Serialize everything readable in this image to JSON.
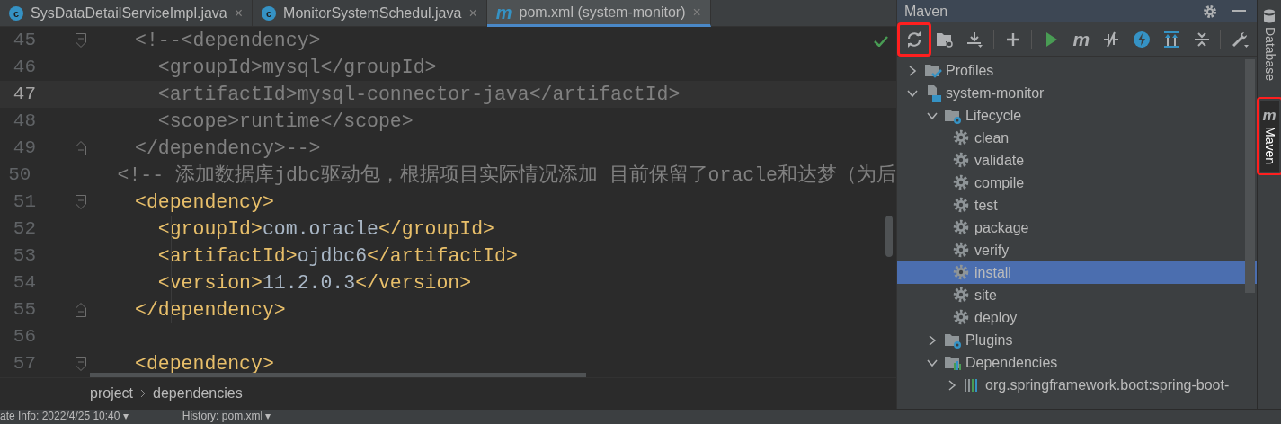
{
  "tabs": [
    {
      "label": "SysDataDetailServiceImpl.java",
      "kind": "class",
      "icon_glyph": "c",
      "close": "×",
      "selected": false
    },
    {
      "label": "MonitorSystemSchedul.java",
      "kind": "class",
      "icon_glyph": "c",
      "close": "×",
      "selected": false
    },
    {
      "label": "pom.xml (system-monitor)",
      "kind": "maven",
      "icon_glyph": "m",
      "close": "×",
      "selected": true
    }
  ],
  "editor": {
    "lines": [
      {
        "number": "45",
        "current": false,
        "fold_start": true,
        "segments": [
          {
            "kind": "comment",
            "text": "<!--<dependency>"
          }
        ]
      },
      {
        "number": "46",
        "current": false,
        "segments": [
          {
            "kind": "comment",
            "text": "  <groupId>mysql</groupId>"
          }
        ]
      },
      {
        "number": "47",
        "current": true,
        "segments": [
          {
            "kind": "comment",
            "text": "  <artifactId>mysql-connector-java</artifactId>"
          }
        ]
      },
      {
        "number": "48",
        "current": false,
        "segments": [
          {
            "kind": "comment",
            "text": "  <scope>runtime</scope>"
          }
        ]
      },
      {
        "number": "49",
        "current": false,
        "fold_end": true,
        "segments": [
          {
            "kind": "comment",
            "text": "</dependency>-->"
          }
        ]
      },
      {
        "number": "50",
        "current": false,
        "segments": [
          {
            "kind": "comment",
            "text": "<!-- 添加数据库jdbc驱动包，根据项目实际情况添加 目前保留了oracle和达梦（为后"
          }
        ]
      },
      {
        "number": "51",
        "current": false,
        "fold_start": true,
        "segments": [
          {
            "kind": "tag",
            "text": "<dependency>"
          }
        ]
      },
      {
        "number": "52",
        "current": false,
        "segments": [
          {
            "kind": "tag",
            "text": "  <groupId>"
          },
          {
            "kind": "text",
            "text": "com.oracle"
          },
          {
            "kind": "tag",
            "text": "</groupId>"
          }
        ]
      },
      {
        "number": "53",
        "current": false,
        "segments": [
          {
            "kind": "tag",
            "text": "  <artifactId>"
          },
          {
            "kind": "text",
            "text": "ojdbc6"
          },
          {
            "kind": "tag",
            "text": "</artifactId>"
          }
        ]
      },
      {
        "number": "54",
        "current": false,
        "segments": [
          {
            "kind": "tag",
            "text": "  <version>"
          },
          {
            "kind": "text",
            "text": "11.2.0.3"
          },
          {
            "kind": "tag",
            "text": "</version>"
          }
        ]
      },
      {
        "number": "55",
        "current": false,
        "fold_end": true,
        "segments": [
          {
            "kind": "tag",
            "text": "</dependency>"
          }
        ]
      },
      {
        "number": "56",
        "current": false
      },
      {
        "number": "57",
        "current": false,
        "fold_start": true,
        "segments": [
          {
            "kind": "tag",
            "text": "<dependency>"
          }
        ]
      }
    ]
  },
  "breadcrumbs": [
    "project",
    "dependencies"
  ],
  "bottom_bar": [
    "ate Info: 2022/4/25 10:40 ▾",
    "History: pom.xml ▾"
  ],
  "maven": {
    "title": "Maven",
    "toolbar": [
      {
        "kind": "reload",
        "highlighted": true
      },
      {
        "kind": "folder-reload",
        "highlighted": false
      },
      {
        "kind": "download",
        "highlighted": false
      },
      {
        "kind": "separator"
      },
      {
        "kind": "add",
        "highlighted": false
      },
      {
        "kind": "separator"
      },
      {
        "kind": "run",
        "highlighted": false
      },
      {
        "kind": "maven",
        "glyph": "m",
        "highlighted": false
      },
      {
        "kind": "offline",
        "highlighted": false
      },
      {
        "kind": "skip-tests",
        "highlighted": false
      },
      {
        "kind": "expand",
        "highlighted": false
      },
      {
        "kind": "collapse",
        "highlighted": false
      },
      {
        "kind": "separator"
      },
      {
        "kind": "settings",
        "highlighted": false
      }
    ],
    "tree": [
      {
        "label": "Profiles",
        "kind": "profiles",
        "expanded": false,
        "selected": false
      },
      {
        "label": "system-monitor",
        "kind": "module",
        "expanded": true,
        "selected": false,
        "children": [
          {
            "label": "Lifecycle",
            "kind": "lifecycle",
            "expanded": true,
            "selected": false,
            "children": [
              {
                "label": "clean",
                "kind": "goal",
                "selected": false
              },
              {
                "label": "validate",
                "kind": "goal",
                "selected": false
              },
              {
                "label": "compile",
                "kind": "goal",
                "selected": false
              },
              {
                "label": "test",
                "kind": "goal",
                "selected": false
              },
              {
                "label": "package",
                "kind": "goal",
                "selected": false
              },
              {
                "label": "verify",
                "kind": "goal",
                "selected": false
              },
              {
                "label": "install",
                "kind": "goal",
                "selected": true
              },
              {
                "label": "site",
                "kind": "goal",
                "selected": false
              },
              {
                "label": "deploy",
                "kind": "goal",
                "selected": false
              }
            ]
          },
          {
            "label": "Plugins",
            "kind": "plugins",
            "expanded": false,
            "selected": false
          },
          {
            "label": "Dependencies",
            "kind": "dependencies",
            "expanded": true,
            "selected": false,
            "children": [
              {
                "label": "org.springframework.boot:spring-boot-",
                "kind": "dependency",
                "expanded": false,
                "selected": false
              }
            ]
          }
        ]
      }
    ]
  },
  "side_tabs": [
    {
      "label": "Database",
      "kind": "database",
      "selected": false,
      "highlighted": false
    },
    {
      "label": "Maven",
      "kind": "maven",
      "glyph": "m",
      "selected": true,
      "highlighted": true
    }
  ]
}
